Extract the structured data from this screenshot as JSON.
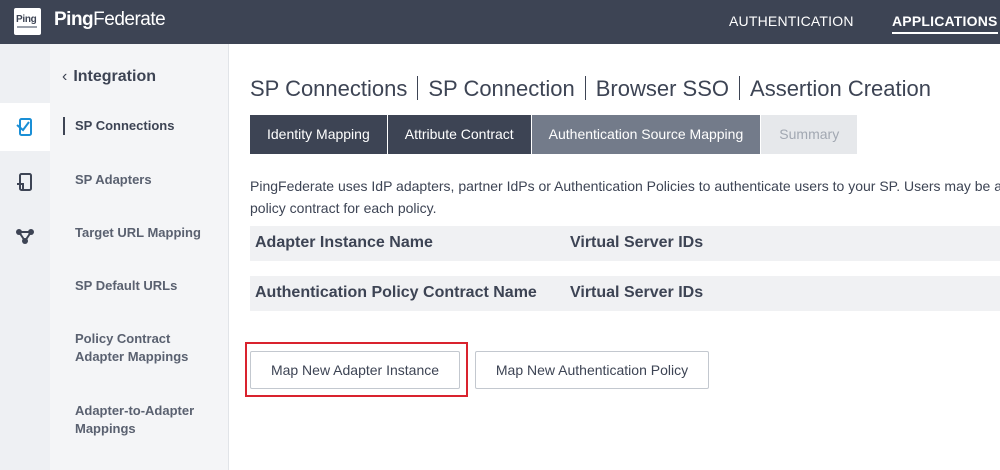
{
  "header": {
    "logo_text": "Ping",
    "brand_prefix": "Ping",
    "brand_suffix": "Federate",
    "nav": [
      {
        "label": "AUTHENTICATION",
        "active": false
      },
      {
        "label": "APPLICATIONS",
        "active": true
      }
    ]
  },
  "rail": {
    "icons": [
      "sp-connections-icon",
      "sp-adapters-icon",
      "target-mapping-icon"
    ]
  },
  "subnav": {
    "back_label": "Integration",
    "items": [
      {
        "label": "SP Connections",
        "active": true
      },
      {
        "label": "SP Adapters",
        "active": false
      },
      {
        "label": "Target URL Mapping",
        "active": false
      },
      {
        "label": "SP Default URLs",
        "active": false
      },
      {
        "label": "Policy Contract Adapter Mappings",
        "active": false
      },
      {
        "label": "Adapter-to-Adapter Mappings",
        "active": false
      }
    ]
  },
  "breadcrumb": [
    "SP Connections",
    "SP Connection",
    "Browser SSO",
    "Assertion Creation"
  ],
  "tabs": [
    {
      "label": "Identity Mapping",
      "state": "done"
    },
    {
      "label": "Attribute Contract",
      "state": "done"
    },
    {
      "label": "Authentication Source Mapping",
      "state": "current"
    },
    {
      "label": "Summary",
      "state": "todo"
    }
  ],
  "description": {
    "line1": "PingFederate uses IdP adapters, partner IdPs or Authentication Policies to authenticate users to your SP. Users may be a",
    "line2": "policy contract for each policy."
  },
  "tables": [
    {
      "col1": "Adapter Instance Name",
      "col2": "Virtual Server IDs"
    },
    {
      "col1": "Authentication Policy Contract Name",
      "col2": "Virtual Server IDs"
    }
  ],
  "buttons": {
    "map_adapter": "Map New Adapter Instance",
    "map_policy": "Map New Authentication Policy"
  },
  "colors": {
    "header_bg": "#3d4454",
    "tab_current": "#737b8a",
    "highlight": "#d9232e"
  }
}
